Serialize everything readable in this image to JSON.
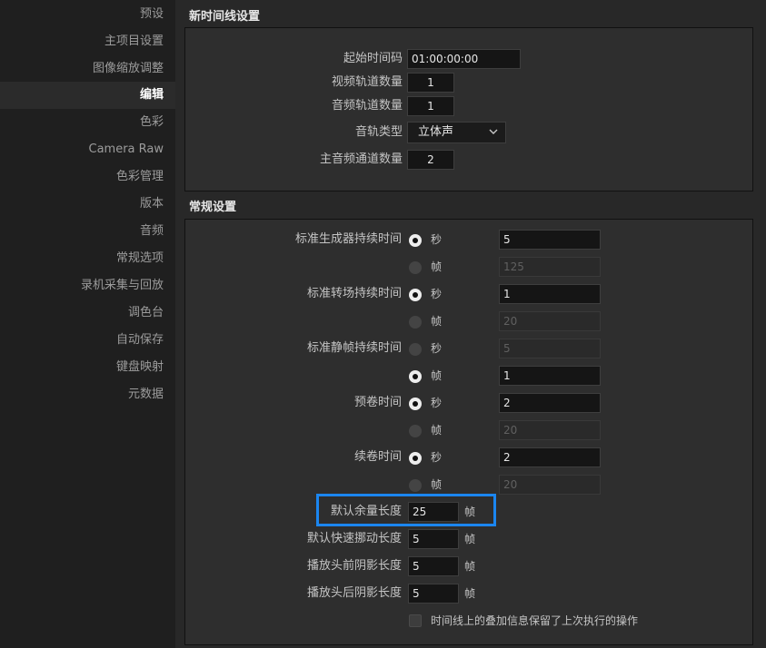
{
  "sidebar": {
    "items": [
      {
        "label": "预设"
      },
      {
        "label": "主项目设置"
      },
      {
        "label": "图像缩放调整"
      },
      {
        "label": "编辑",
        "active": true
      },
      {
        "label": "色彩"
      },
      {
        "label": "Camera Raw"
      },
      {
        "label": "色彩管理"
      },
      {
        "label": "版本"
      },
      {
        "label": "音频"
      },
      {
        "label": "常规选项"
      },
      {
        "label": "录机采集与回放"
      },
      {
        "label": "调色台"
      },
      {
        "label": "自动保存"
      },
      {
        "label": "键盘映射"
      },
      {
        "label": "元数据"
      }
    ]
  },
  "timeline": {
    "title": "新时间线设置",
    "start_tc_label": "起始时间码",
    "start_tc_value": "01:00:00:00",
    "video_tracks_label": "视频轨道数量",
    "video_tracks_value": "1",
    "audio_tracks_label": "音频轨道数量",
    "audio_tracks_value": "1",
    "audio_type_label": "音轨类型",
    "audio_type_value": "立体声",
    "main_audio_ch_label": "主音频通道数量",
    "main_audio_ch_value": "2"
  },
  "general": {
    "title": "常规设置",
    "sec_label": "秒",
    "frame_label": "帧",
    "rows": [
      {
        "label": "标准生成器持续时间",
        "sec_value": "5",
        "frame_value": "125",
        "mode": "sec"
      },
      {
        "label": "标准转场持续时间",
        "sec_value": "1",
        "frame_value": "20",
        "mode": "sec"
      },
      {
        "label": "标准静帧持续时间",
        "sec_value": "5",
        "frame_value": "1",
        "mode": "frame"
      },
      {
        "label": "预卷时间",
        "sec_value": "2",
        "frame_value": "20",
        "mode": "sec"
      },
      {
        "label": "续卷时间",
        "sec_value": "2",
        "frame_value": "20",
        "mode": "sec"
      }
    ],
    "handles": [
      {
        "label": "默认余量长度",
        "value": "25",
        "unit": "帧"
      },
      {
        "label": "默认快速挪动长度",
        "value": "5",
        "unit": "帧"
      },
      {
        "label": "播放头前阴影长度",
        "value": "5",
        "unit": "帧"
      },
      {
        "label": "播放头后阴影长度",
        "value": "5",
        "unit": "帧"
      }
    ],
    "overlay_checkbox_label": "时间线上的叠加信息保留了上次执行的操作"
  },
  "colors": {
    "highlight": "#1b86f0"
  }
}
